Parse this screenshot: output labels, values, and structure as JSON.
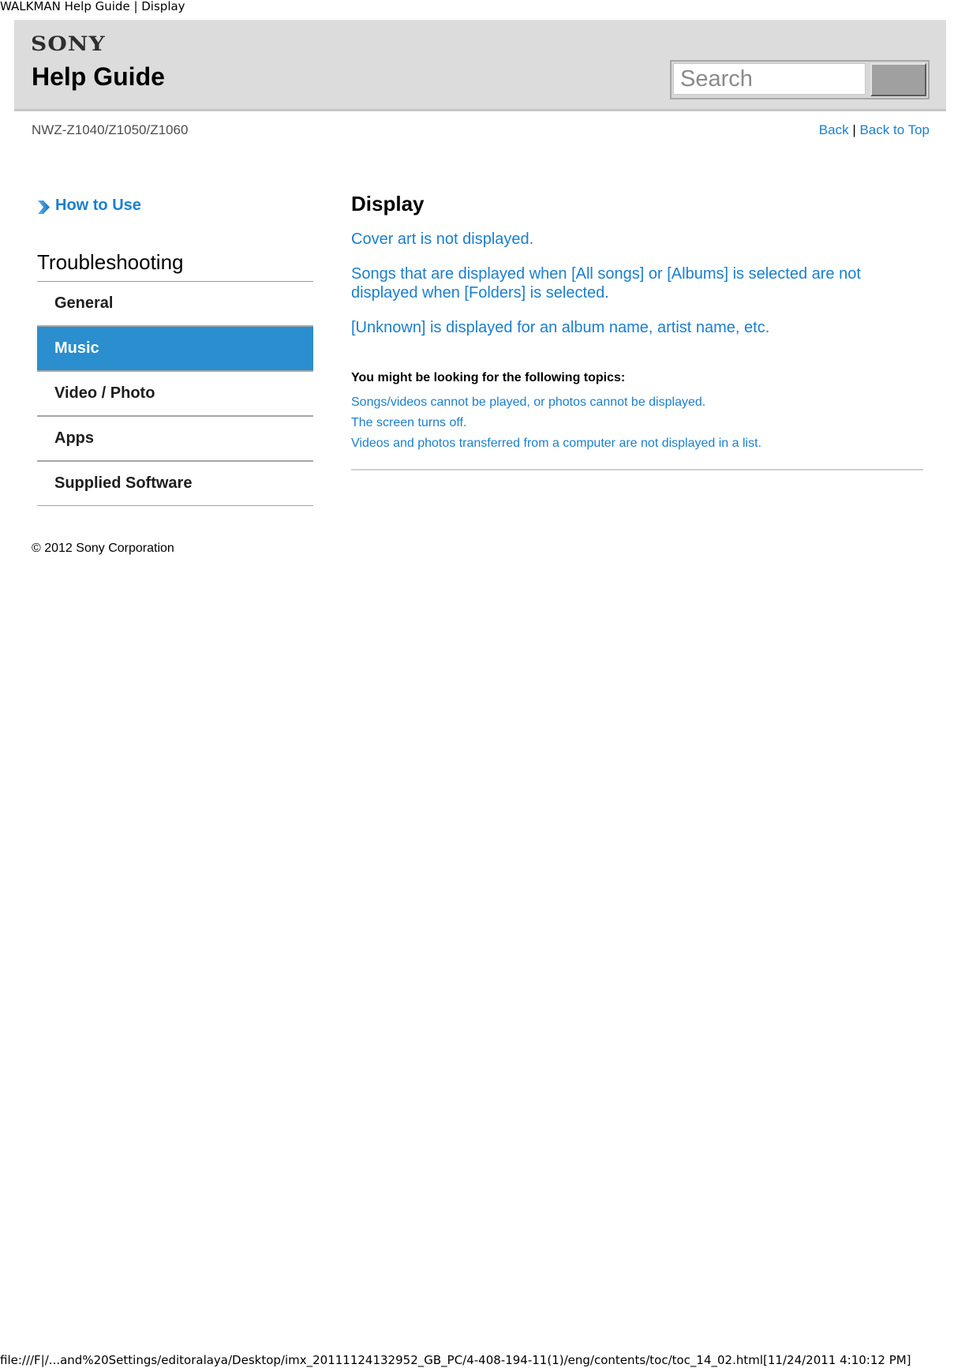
{
  "window": {
    "title": "WALKMAN Help Guide | Display"
  },
  "header": {
    "brand": "SONY",
    "title": "Help Guide",
    "search": {
      "placeholder": "Search",
      "value": "",
      "button_label": ""
    }
  },
  "subheader": {
    "model": "NWZ-Z1040/Z1050/Z1060",
    "back_label": "Back",
    "separator": "|",
    "back_to_top_label": "Back to Top"
  },
  "sidebar": {
    "how_to_use": {
      "label": "How to Use",
      "icon": "chevron-right-icon"
    },
    "section_heading": "Troubleshooting",
    "items": [
      {
        "label": "General",
        "active": false
      },
      {
        "label": "Music",
        "active": true
      },
      {
        "label": "Video / Photo",
        "active": false
      },
      {
        "label": "Apps",
        "active": false
      },
      {
        "label": "Supplied Software",
        "active": false
      }
    ],
    "active_color": "#2a8ecf"
  },
  "main": {
    "heading": "Display",
    "topics": [
      "Cover art is not displayed.",
      "Songs that are displayed when [All songs] or [Albums] is selected are not displayed when [Folders] is selected.",
      "[Unknown] is displayed for an album name, artist name, etc."
    ],
    "related": {
      "heading": "You might be looking for the following topics:",
      "items": [
        "Songs/videos cannot be played, or photos cannot be displayed.",
        "The screen turns off.",
        "Videos and photos transferred from a computer are not displayed in a list."
      ]
    }
  },
  "footer": {
    "copyright": "© 2012 Sony Corporation",
    "file_path": "file:///F|/...and%20Settings/editoralaya/Desktop/imx_20111124132952_GB_PC/4-408-194-11(1)/eng/contents/toc/toc_14_02.html[11/24/2011 4:10:12 PM]"
  },
  "colors": {
    "link": "#1a7fcf",
    "header_bg": "#dcdcdc",
    "active_nav": "#2a8ecf"
  }
}
